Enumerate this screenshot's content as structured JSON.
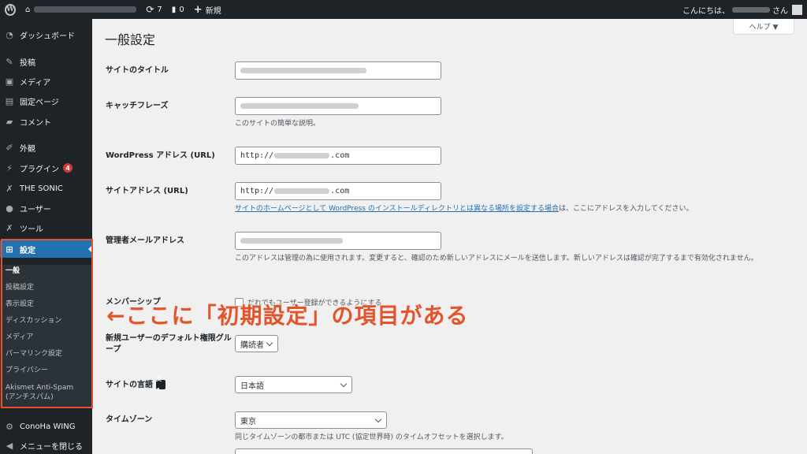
{
  "adminbar": {
    "updates_count": "7",
    "comments_count": "0",
    "new_label": "新規",
    "greeting": "こんにちは、",
    "greeting_suffix": "さん"
  },
  "sidebar": {
    "items": [
      {
        "label": "ダッシュボード",
        "icon": "dashboard-icon"
      },
      {
        "label": "投稿",
        "icon": "pin-icon"
      },
      {
        "label": "メディア",
        "icon": "media-icon"
      },
      {
        "label": "固定ページ",
        "icon": "page-icon"
      },
      {
        "label": "コメント",
        "icon": "comment-icon"
      },
      {
        "label": "外観",
        "icon": "brush-icon"
      },
      {
        "label": "プラグイン",
        "icon": "plugin-icon",
        "badge": "4"
      },
      {
        "label": "THE SONIC",
        "icon": "wrench-icon"
      },
      {
        "label": "ユーザー",
        "icon": "user-icon"
      },
      {
        "label": "ツール",
        "icon": "tool-icon"
      },
      {
        "label": "設定",
        "icon": "settings-icon"
      },
      {
        "label": "ConoHa WING",
        "icon": "gear-icon"
      },
      {
        "label": "メニューを閉じる",
        "icon": "collapse-icon"
      }
    ],
    "submenu": [
      "一般",
      "投稿設定",
      "表示設定",
      "ディスカッション",
      "メディア",
      "パーマリンク設定",
      "プライバシー",
      "Akismet Anti-Spam",
      "(アンチスパム)"
    ]
  },
  "main": {
    "help_label": "ヘルプ ▼",
    "title": "一般設定",
    "site_title_label": "サイトのタイトル",
    "tagline_label": "キャッチフレーズ",
    "tagline_desc": "このサイトの簡単な説明。",
    "wp_address_label": "WordPress アドレス (URL)",
    "wp_address_value": "http://",
    "wp_address_suffix": ".com",
    "site_address_label": "サイトアドレス (URL)",
    "site_address_value": "http://",
    "site_address_suffix": ".com",
    "site_address_link": "サイトのホームページとして WordPress のインストールディレクトリとは異なる場所を設定する場合",
    "site_address_desc_tail": "は、ここにアドレスを入力してください。",
    "admin_email_label": "管理者メールアドレス",
    "admin_email_desc": "このアドレスは管理の為に使用されます。変更すると、確認のため新しいアドレスにメールを送信します。新しいアドレスは確認が完了するまで有効化されません。",
    "membership_label": "メンバーシップ",
    "membership_check": "だれでもユーザー登録ができるようにする",
    "default_role_label": "新規ユーザーのデフォルト権限グループ",
    "default_role_value": "購読者",
    "language_label": "サイトの言語",
    "language_value": "日本語",
    "timezone_label": "タイムゾーン",
    "timezone_value": "東京",
    "timezone_desc": "同じタイムゾーンの都市または UTC (協定世界時) のタイムオフセットを選択します。"
  },
  "annotation": "←ここに「初期設定」の項目がある",
  "colors": {
    "accent": "#2271b1",
    "annotation": "#e4542b",
    "sidebar": "#1d2327"
  }
}
